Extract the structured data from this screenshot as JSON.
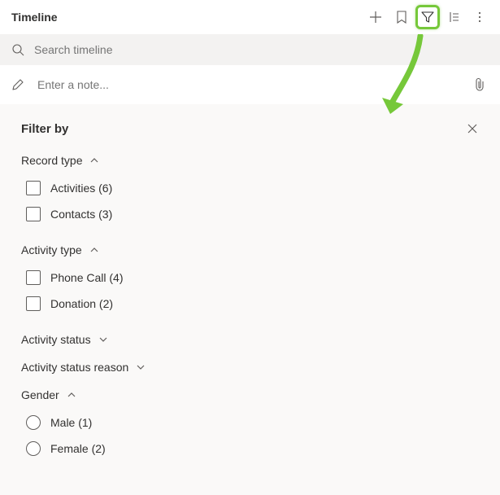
{
  "header": {
    "title": "Timeline"
  },
  "search": {
    "placeholder": "Search timeline"
  },
  "note": {
    "placeholder": "Enter a note..."
  },
  "filter": {
    "title": "Filter by",
    "sections": {
      "recordType": {
        "label": "Record type",
        "expanded": true,
        "options": [
          {
            "label": "Activities (6)"
          },
          {
            "label": "Contacts (3)"
          }
        ]
      },
      "activityType": {
        "label": "Activity type",
        "expanded": true,
        "options": [
          {
            "label": "Phone Call (4)"
          },
          {
            "label": "Donation (2)"
          }
        ]
      },
      "activityStatus": {
        "label": "Activity status",
        "expanded": false
      },
      "activityStatusReason": {
        "label": "Activity status reason",
        "expanded": false
      },
      "gender": {
        "label": "Gender",
        "expanded": true,
        "options": [
          {
            "label": "Male (1)"
          },
          {
            "label": "Female (2)"
          }
        ]
      }
    }
  },
  "colors": {
    "highlight": "#76c83a"
  }
}
